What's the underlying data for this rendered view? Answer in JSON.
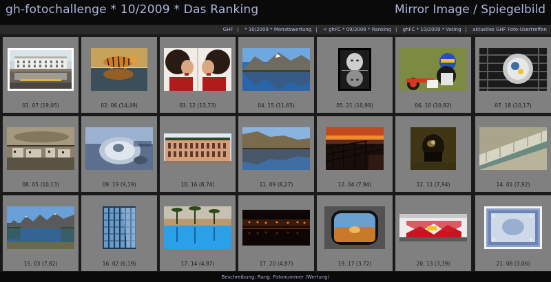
{
  "header": {
    "title": "gh-fotochallenge * 10/2009 * Das Ranking",
    "theme": "Mirror Image / Spiegelbild"
  },
  "nav": {
    "links": [
      "GHF",
      "* 10/2009 * Monatswertung",
      "< ghFC * 09/2008 * Ranking",
      "ghFC * 10/2009 * Voting",
      "aktuelles GHF Foto-Usertreffen"
    ]
  },
  "entries": [
    {
      "caption": "01. 07 (19,05)"
    },
    {
      "caption": "02. 06 (14,49)"
    },
    {
      "caption": "03. 12 (13,73)"
    },
    {
      "caption": "04. 15 (11,65)"
    },
    {
      "caption": "05. 21 (10,99)"
    },
    {
      "caption": "06. 10 (10,92)"
    },
    {
      "caption": "07. 18 (10,17)"
    },
    {
      "caption": "08. 05 (10,13)"
    },
    {
      "caption": "09. 19 (9,19)"
    },
    {
      "caption": "10. 16 (8,74)"
    },
    {
      "caption": "11. 09 (8,27)"
    },
    {
      "caption": "12. 04 (7,94)"
    },
    {
      "caption": "12. 11 (7,94)"
    },
    {
      "caption": "14. 01 (7,92)"
    },
    {
      "caption": "15. 03 (7,82)"
    },
    {
      "caption": "16. 02 (6,19)"
    },
    {
      "caption": "17. 14 (4,87)"
    },
    {
      "caption": "17. 20 (4,87)"
    },
    {
      "caption": "19. 17 (3,72)"
    },
    {
      "caption": "20. 13 (3,39)"
    },
    {
      "caption": "21. 08 (3,06)"
    }
  ],
  "footer": {
    "text": "Beschreibung: Rang. Fotonummer (Wertung)"
  }
}
